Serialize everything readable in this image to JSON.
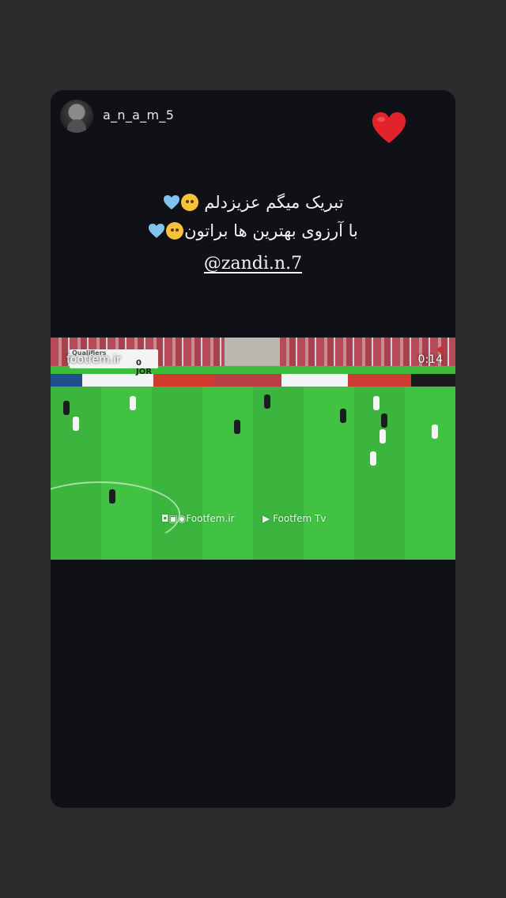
{
  "story": {
    "username": "a_n_a_m_5",
    "reaction_icon": "heart-icon",
    "caption_line1": "تبریک میگم عزیزدلم",
    "caption_line2": "با آرزوی بهترین ها براتون",
    "mention": "@zandi.n.7"
  },
  "video": {
    "brand": "footfem.ir",
    "time": "0:14",
    "scoreboard_title": "Qualifiers",
    "scoreboard_score": "0  JOR",
    "watermark_left": "Footfem.ir",
    "watermark_right": "Footfem Tv",
    "colors": {
      "pitch": "#3dbc3e",
      "stands": "#b84b5a"
    }
  },
  "colors": {
    "background": "#2a2b2d",
    "card": "#101116",
    "heart": "#e3232c",
    "blue_heart": "#7fc4ee"
  }
}
